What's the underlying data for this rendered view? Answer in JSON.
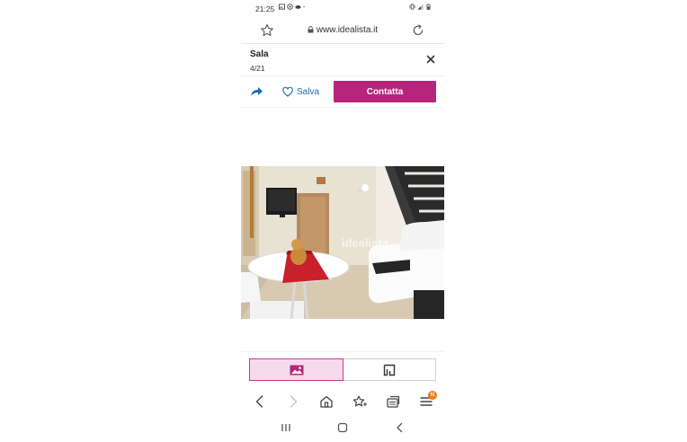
{
  "status_bar": {
    "time": "21:25",
    "left_icons": [
      "gallery-icon",
      "whatsapp-icon",
      "cloud-icon",
      "dot-icon"
    ],
    "right_icons": [
      "vibrate-icon",
      "signal-icon",
      "battery-icon"
    ]
  },
  "browser": {
    "url": "www.idealista.it",
    "secure": true
  },
  "gallery": {
    "title": "Sala",
    "counter": "4/21"
  },
  "actions": {
    "save_label": "Salva",
    "contact_label": "Contatta"
  },
  "photo": {
    "watermark": "idealista",
    "description_icon": "living-room-photo"
  },
  "view_toggle": {
    "selected": "photos",
    "options": [
      "photos",
      "floor-plan"
    ]
  },
  "browser_nav": {
    "items": [
      "back",
      "forward",
      "home",
      "bookmarks",
      "tabs",
      "menu"
    ],
    "menu_badge": "N"
  },
  "system_nav": {
    "items": [
      "recent-apps",
      "home",
      "back"
    ]
  },
  "colors": {
    "brand": "#b6257b",
    "brand_light": "#f7d9ec",
    "link": "#1d6ab0",
    "badge": "#f07a1a"
  }
}
